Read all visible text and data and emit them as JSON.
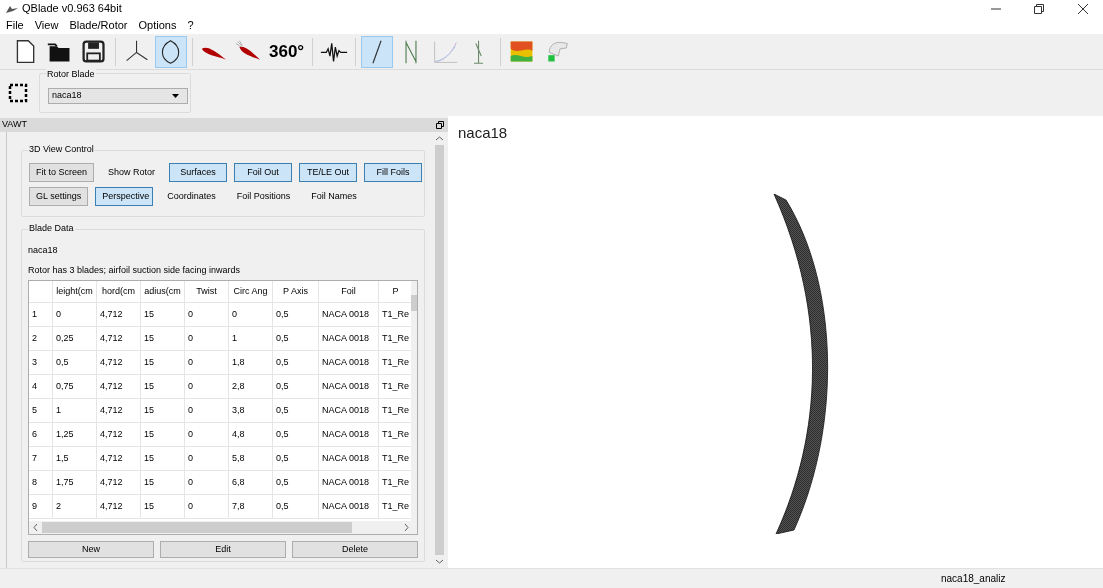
{
  "window": {
    "title": "QBlade v0.963 64bit"
  },
  "menu": [
    "File",
    "View",
    "Blade/Rotor",
    "Options",
    "?"
  ],
  "toolbar": [
    {
      "kind": "new",
      "selected": false
    },
    {
      "kind": "open",
      "selected": false
    },
    {
      "kind": "save",
      "selected": false
    },
    {
      "kind": "sep"
    },
    {
      "kind": "turbine",
      "selected": false
    },
    {
      "kind": "blade",
      "selected": true
    },
    {
      "kind": "sep"
    },
    {
      "kind": "airfoil",
      "selected": false
    },
    {
      "kind": "polar",
      "selected": false
    },
    {
      "kind": "text",
      "label": "360°",
      "selected": false
    },
    {
      "kind": "sep"
    },
    {
      "kind": "wave",
      "selected": false
    },
    {
      "kind": "sep"
    },
    {
      "kind": "line",
      "selected": true
    },
    {
      "kind": "vawt",
      "selected": false
    },
    {
      "kind": "graph",
      "selected": false
    },
    {
      "kind": "mast",
      "selected": false
    },
    {
      "kind": "sep"
    },
    {
      "kind": "map",
      "selected": false
    },
    {
      "kind": "hand",
      "selected": false
    }
  ],
  "rotor_blade": {
    "label": "Rotor Blade",
    "value": "naca18"
  },
  "dock": {
    "title": "VAWT"
  },
  "view_control": {
    "title": "3D View Control",
    "rows": [
      [
        {
          "label": "Fit to Screen",
          "kind": "push",
          "selected": false
        },
        {
          "label": "Show Rotor",
          "kind": "toggle",
          "selected": false
        },
        {
          "label": "Surfaces",
          "kind": "toggle",
          "selected": true
        },
        {
          "label": "Foil Out",
          "kind": "toggle",
          "selected": true
        },
        {
          "label": "TE/LE Out",
          "kind": "toggle",
          "selected": true
        },
        {
          "label": "Fill Foils",
          "kind": "toggle",
          "selected": true
        }
      ],
      [
        {
          "label": "GL settings",
          "kind": "push",
          "selected": false
        },
        {
          "label": "Perspective",
          "kind": "toggle",
          "selected": true
        },
        {
          "label": "Coordinates",
          "kind": "toggle",
          "selected": false
        },
        {
          "label": "Foil Positions",
          "kind": "toggle",
          "selected": false
        },
        {
          "label": "Foil Names",
          "kind": "toggle",
          "selected": false
        }
      ]
    ]
  },
  "blade_data": {
    "title": "Blade Data",
    "name": "naca18",
    "info": "Rotor has 3 blades; airfoil suction side facing inwards",
    "columns": [
      "",
      "leight(cm",
      "hord(cm",
      "adius(cm",
      "Twist",
      "Circ Ang",
      "P Axis",
      "Foil",
      "P"
    ],
    "rows": [
      [
        "1",
        "0",
        "4,712",
        "15",
        "0",
        "0",
        "0,5",
        "NACA 0018",
        "T1_Re"
      ],
      [
        "2",
        "0,25",
        "4,712",
        "15",
        "0",
        "1",
        "0,5",
        "NACA 0018",
        "T1_Re"
      ],
      [
        "3",
        "0,5",
        "4,712",
        "15",
        "0",
        "1,8",
        "0,5",
        "NACA 0018",
        "T1_Re"
      ],
      [
        "4",
        "0,75",
        "4,712",
        "15",
        "0",
        "2,8",
        "0,5",
        "NACA 0018",
        "T1_Re"
      ],
      [
        "5",
        "1",
        "4,712",
        "15",
        "0",
        "3,8",
        "0,5",
        "NACA 0018",
        "T1_Re"
      ],
      [
        "6",
        "1,25",
        "4,712",
        "15",
        "0",
        "4,8",
        "0,5",
        "NACA 0018",
        "T1_Re"
      ],
      [
        "7",
        "1,5",
        "4,712",
        "15",
        "0",
        "5,8",
        "0,5",
        "NACA 0018",
        "T1_Re"
      ],
      [
        "8",
        "1,75",
        "4,712",
        "15",
        "0",
        "6,8",
        "0,5",
        "NACA 0018",
        "T1_Re"
      ],
      [
        "9",
        "2",
        "4,712",
        "15",
        "0",
        "7,8",
        "0,5",
        "NACA 0018",
        "T1_Re"
      ]
    ],
    "buttons": [
      "New",
      "Edit",
      "Delete"
    ]
  },
  "view": {
    "title": "naca18"
  },
  "status_bar": {
    "text": "naca18_analiz"
  }
}
